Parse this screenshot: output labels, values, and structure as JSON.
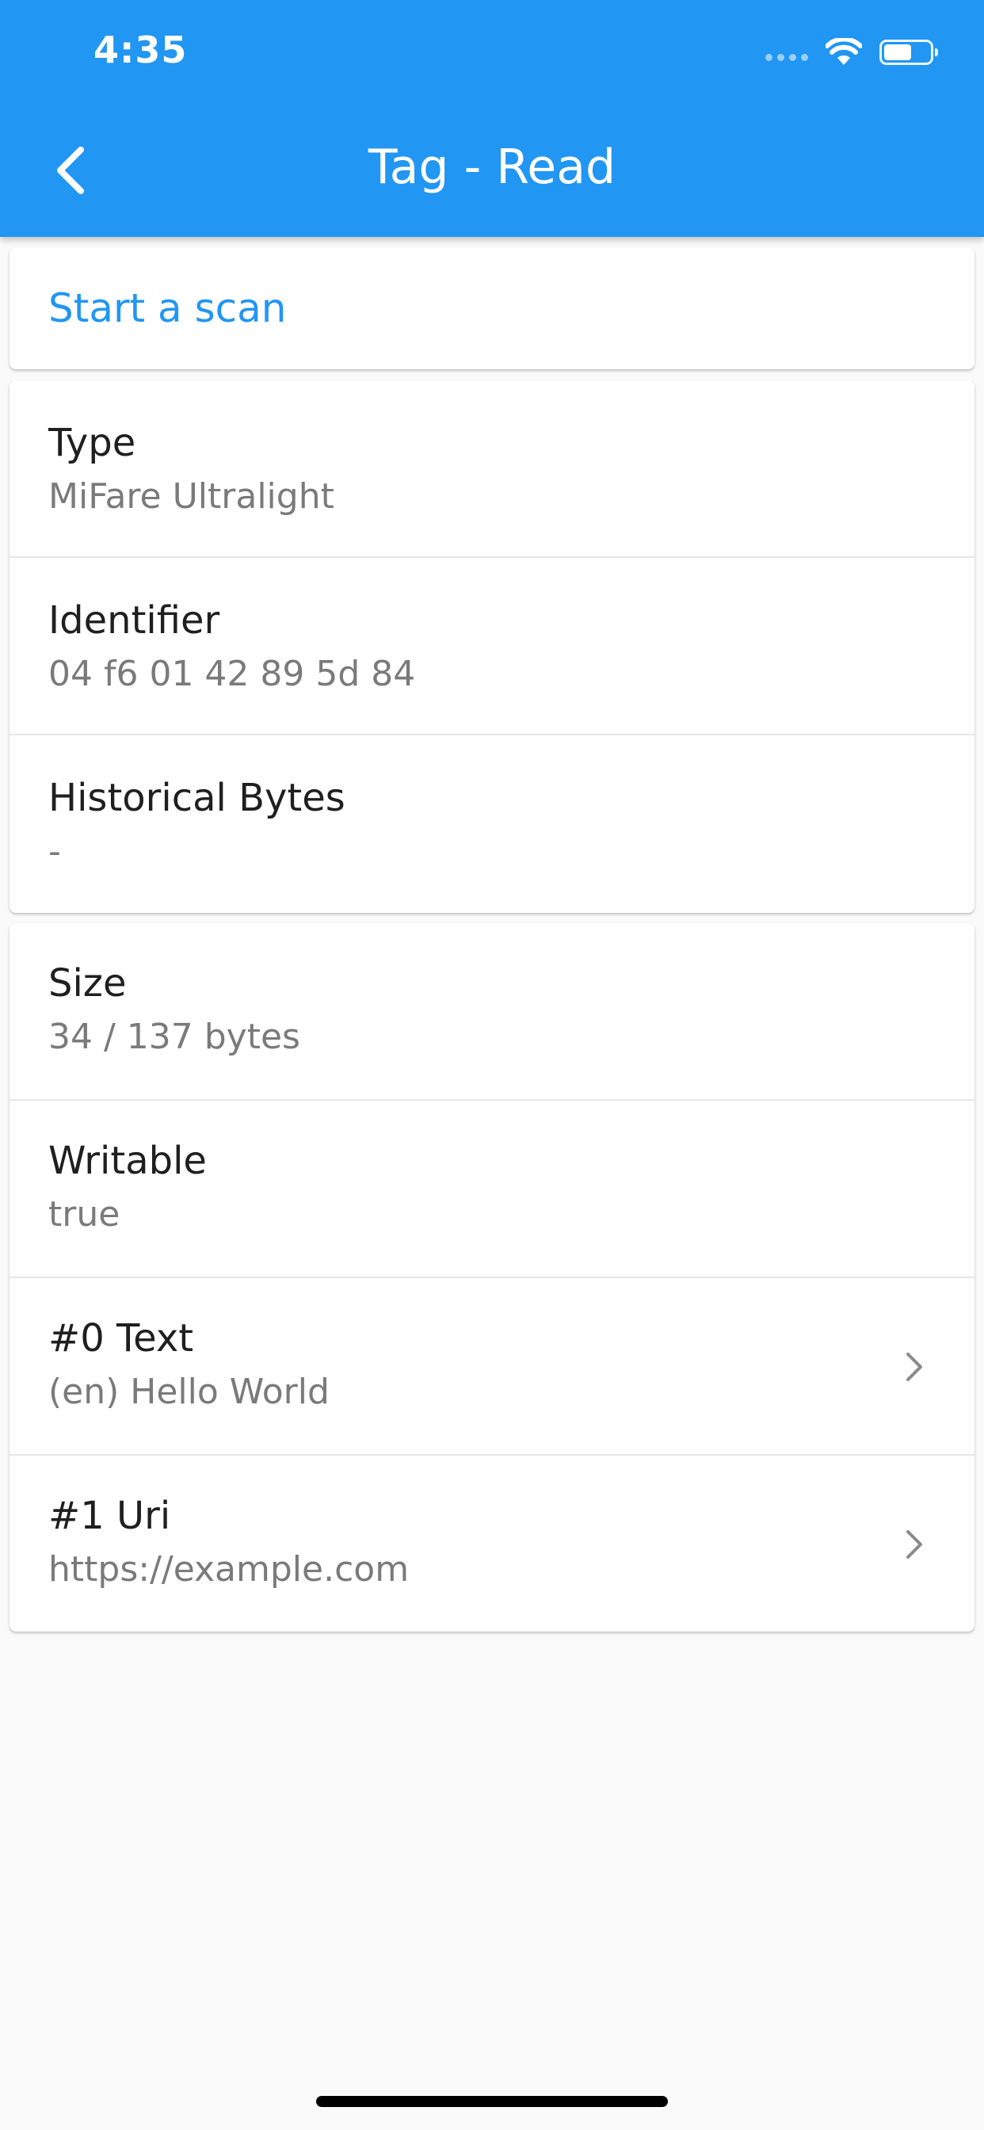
{
  "status_bar": {
    "time": "4:35"
  },
  "app_bar": {
    "title": "Tag - Read",
    "back_icon": "chevron-left-icon",
    "color": "#2196f3"
  },
  "scan": {
    "label": "Start a scan"
  },
  "tag_info": [
    {
      "title": "Type",
      "value": "MiFare Ultralight"
    },
    {
      "title": "Identifier",
      "value": "04 f6 01 42 89 5d 84"
    },
    {
      "title": "Historical Bytes",
      "value": "-"
    }
  ],
  "ndef": [
    {
      "title": "Size",
      "value": "34 / 137 bytes"
    },
    {
      "title": "Writable",
      "value": "true"
    },
    {
      "title": "#0 Text",
      "value": "(en) Hello World"
    },
    {
      "title": "#1 Uri",
      "value": "https://example.com"
    }
  ]
}
